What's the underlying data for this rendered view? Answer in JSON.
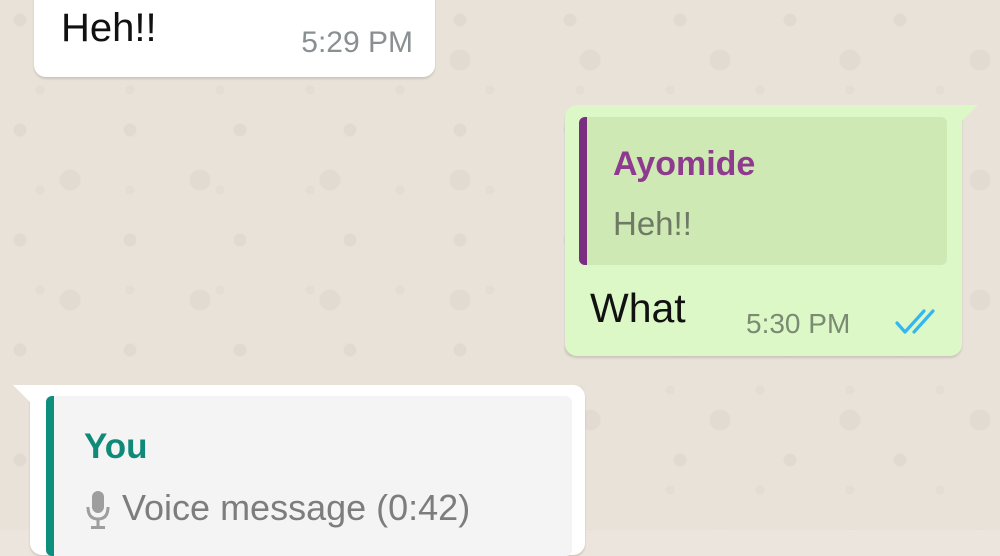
{
  "messages": [
    {
      "direction": "incoming",
      "text": "Heh!!",
      "time": "5:29 PM"
    },
    {
      "direction": "outgoing",
      "quoted": {
        "author": "Ayomide",
        "text": "Heh!!"
      },
      "text": "What",
      "time": "5:30 PM",
      "status_icon": "double-check-icon"
    },
    {
      "direction": "incoming",
      "quoted": {
        "author": "You",
        "icon": "mic-icon",
        "text": "Voice message (0:42)"
      }
    }
  ],
  "colors": {
    "chat_background": "#ece5dd",
    "incoming_bubble": "#ffffff",
    "outgoing_bubble": "#dcf8c6",
    "quote_ayomide_accent": "#7b2d82",
    "quote_you_accent": "#0c8f7d",
    "read_ticks": "#34b7f1"
  }
}
